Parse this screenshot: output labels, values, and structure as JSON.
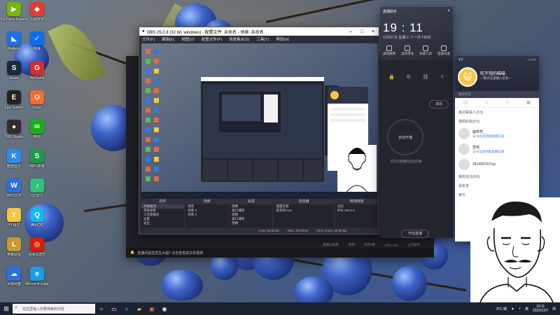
{
  "desktop": {
    "icons": [
      {
        "label": "GeForce Experience",
        "glyph": "▶",
        "color": "#76b900"
      },
      {
        "label": "火绒安全",
        "glyph": "◆",
        "color": "#e03c31"
      },
      {
        "label": "Radeon",
        "glyph": "◣",
        "color": "#1a73e8"
      },
      {
        "label": "快速",
        "glyph": "✓",
        "color": "#0b6ff3"
      },
      {
        "label": "Steam",
        "glyph": "S",
        "color": "#1b2838"
      },
      {
        "label": "WeGame",
        "glyph": "G",
        "color": "#d32f2f"
      },
      {
        "label": "Epic Games",
        "glyph": "E",
        "color": "#222"
      },
      {
        "label": "Origin",
        "glyph": "O",
        "color": "#f56c2d"
      },
      {
        "label": "OBS Studio",
        "glyph": "●",
        "color": "#302e31"
      },
      {
        "label": "微信",
        "glyph": "✉",
        "color": "#1aad19"
      },
      {
        "label": "酷狗音乐",
        "glyph": "K",
        "color": "#2a8cf0"
      },
      {
        "label": "WPS表格",
        "glyph": "S",
        "color": "#1c9b4c"
      },
      {
        "label": "WPS文字",
        "glyph": "W",
        "color": "#2c6fe0"
      },
      {
        "label": "QQ音乐",
        "glyph": "♪",
        "color": "#31c27c"
      },
      {
        "label": "YY语音",
        "glyph": "Y",
        "color": "#f6c643"
      },
      {
        "label": "腾讯QQ",
        "glyph": "Q",
        "color": "#12b7f5"
      },
      {
        "label": "英雄联盟",
        "glyph": "L",
        "color": "#c99a2e"
      },
      {
        "label": "网易云音乐",
        "glyph": "◎",
        "color": "#d81e06"
      },
      {
        "label": "百度网盘",
        "glyph": "☁",
        "color": "#2e6fe5"
      },
      {
        "label": "Microsoft Edge",
        "glyph": "e",
        "color": "#1b9ce6"
      }
    ]
  },
  "obs": {
    "title": "OBS 25.0.8 (32 bit, windows) - 配置文件: 未命名 - 场景: 未命名",
    "menu": [
      "文件(F)",
      "编辑(E)",
      "视图(V)",
      "配置文件(P)",
      "场景集合(S)",
      "工具(T)",
      "帮助(H)"
    ],
    "docks": {
      "controls": {
        "title": "控件",
        "items": [
          "开始推流",
          "开始录制",
          "工作室模式",
          "设置",
          "退出"
        ]
      },
      "scenes": {
        "title": "场景",
        "items": [
          "场景",
          "场景 2",
          "场景 3"
        ]
      },
      "sources": {
        "title": "来源",
        "items": [
          "图像",
          "窗口捕获",
          "图像",
          "窗口捕获",
          "图像"
        ]
      },
      "mixer": {
        "title": "混音器",
        "items": [
          "桌面音频",
          "麦克风/Aux"
        ]
      },
      "transitions": {
        "title": "转场特效",
        "items": [
          "淡出",
          "时长 250 ms"
        ]
      }
    },
    "status": [
      "LIVE: 00:00:00",
      "REC: 00:00:00",
      "CPU: 0.5%, 30.00 fps"
    ]
  },
  "bgapp": {
    "notice": "直播间首选发生大幅? 点击查看前文的视频",
    "stats": [
      "直播分辨率",
      "帧率",
      "码率/帧",
      "CPU: 0%",
      "上行速率"
    ]
  },
  "assistant": {
    "title": "直播助手",
    "time": "19 : 11",
    "date": "12月07日 星期三 十一月十四日",
    "tools": [
      "虚拟摄像",
      "道具特效",
      "快捷工具",
      "直播设置"
    ],
    "exit_label": "退出",
    "auto_label": "自动开播",
    "hint": "开启后直播间自动开播",
    "bottom_btn": "开始直播"
  },
  "yy": {
    "app": "YY",
    "username": "吃不饱的喵喵",
    "signature": "一键点这里输入签名~",
    "search_placeholder": "搜索好友",
    "groups": [
      "最近联系人(2/3)",
      "我的好友(0/1)",
      "我的关注(0/0)",
      "黑名单",
      "官方"
    ],
    "friends": [
      {
        "name": "鹿乖乖_",
        "status": "与Ta互动领取直播记录"
      },
      {
        "name": "雪晴",
        "status": "与Ta互动领取直播记录"
      },
      {
        "name": "2814007037yp",
        "status": ""
      }
    ]
  },
  "taskbar": {
    "search_placeholder": "在这里输入你要搜索的内容",
    "weather": "9°C 晴",
    "tray_lang": "英",
    "time": "19:11",
    "date": "2022/12/7"
  }
}
